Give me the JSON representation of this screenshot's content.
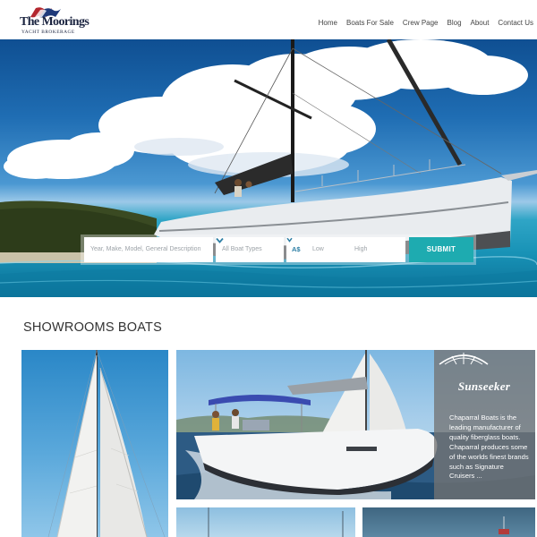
{
  "header": {
    "logo": {
      "name": "The Moorings",
      "tagline": "YACHT BROKERAGE"
    },
    "nav": [
      {
        "label": "Home"
      },
      {
        "label": "Boats For Sale"
      },
      {
        "label": "Crew Page"
      },
      {
        "label": "Blog"
      },
      {
        "label": "About"
      },
      {
        "label": "Contact Us"
      }
    ]
  },
  "search": {
    "keyword_placeholder": "Year, Make, Model, General Description",
    "boat_type_selected": "All Boat Types",
    "currency": "A$",
    "price_low_placeholder": "Low",
    "price_high_placeholder": "High",
    "submit_label": "SUBMIT"
  },
  "showroom": {
    "title": "SHOWROOMS BOATS",
    "featured": {
      "brand": "Sunseeker",
      "description": "Chaparral Boats is the leading manufacturer of quality fiberglass boats. Chaparral produces some of the worlds finest brands such as Signature Cruisers ..."
    }
  },
  "colors": {
    "accent": "#1eabb0",
    "header_text": "#444444",
    "logo_navy": "#1b2440",
    "overlay": "#737373"
  },
  "icons": {
    "boat_type_select": "chevron-down-icon",
    "currency_select": "chevron-down-icon",
    "logo_mark": "flag-icon"
  }
}
